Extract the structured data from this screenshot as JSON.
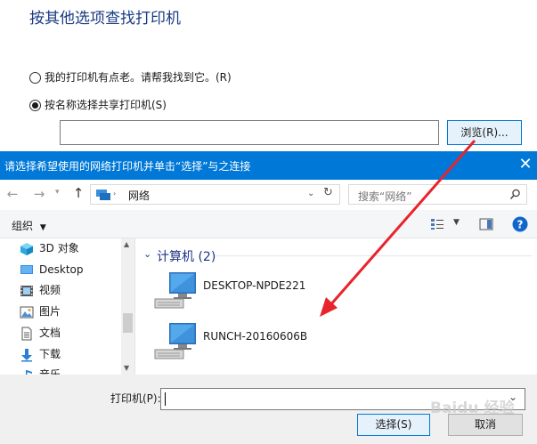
{
  "wizard": {
    "title": "按其他选项查找打印机",
    "option_old": "我的打印机有点老。请帮我找到它。(R)",
    "option_share": "按名称选择共享打印机(S)",
    "share_value": "",
    "browse_label": "浏览(R)..."
  },
  "dialog": {
    "title": "请选择希望使用的网络打印机并单击“选择”与之连接",
    "close": "✕",
    "address": "网络",
    "search_placeholder": "搜索“网络”",
    "organize": "组织",
    "nav_items": [
      {
        "label": "3D 对象"
      },
      {
        "label": "Desktop"
      },
      {
        "label": "视频"
      },
      {
        "label": "图片"
      },
      {
        "label": "文档"
      },
      {
        "label": "下载"
      },
      {
        "label": "音乐"
      }
    ],
    "group_header": "计算机 (2)",
    "computers": [
      {
        "name": "DESKTOP-NPDE221"
      },
      {
        "name": "RUNCH-20160606B"
      }
    ],
    "printer_label": "打印机(P):",
    "printer_value": "",
    "select_label": "选择(S)",
    "cancel_label": "取消"
  },
  "watermark": "Baidu 经验",
  "colors": {
    "accent": "#0078d7",
    "arrow": "#e8242b"
  }
}
